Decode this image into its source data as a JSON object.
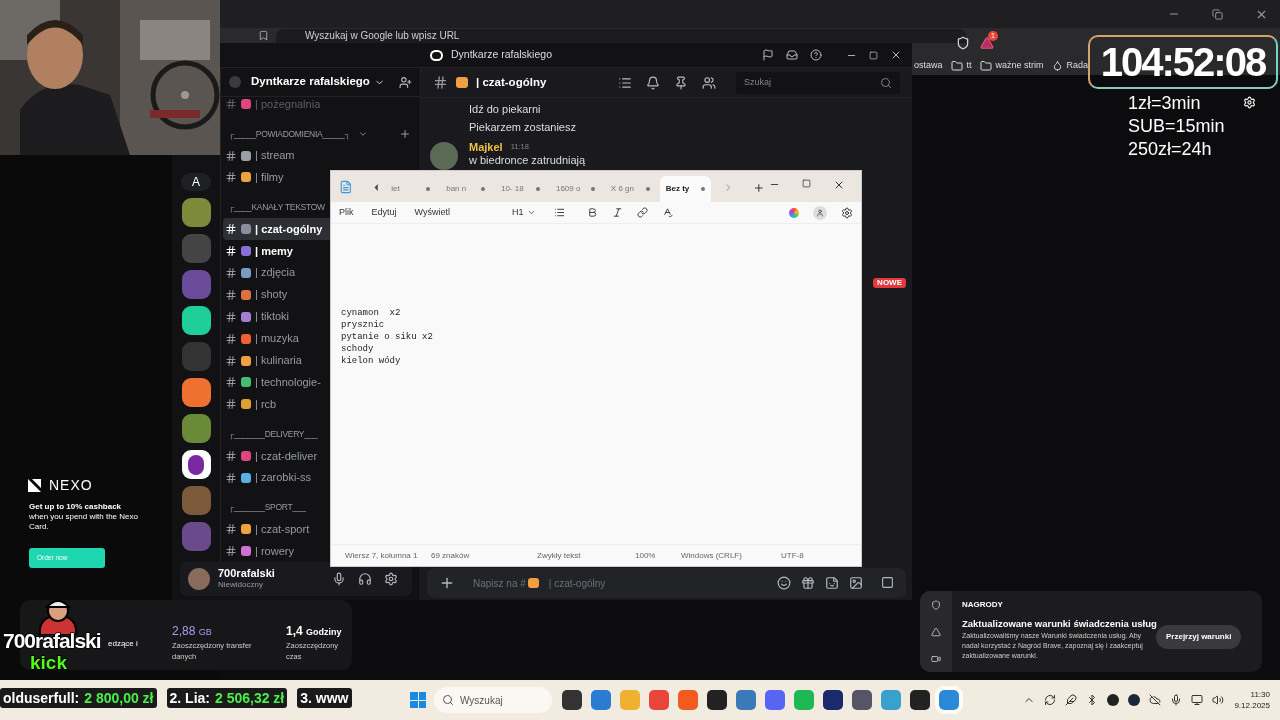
{
  "browser": {
    "address_placeholder": "Wyszukaj w Google lub wpisz URL",
    "rewards_badge": "1",
    "bookmarks": [
      "ostawa",
      "tt",
      "ważne strim",
      "Rada"
    ]
  },
  "timer": {
    "time": "104:52:08",
    "rates": [
      "1zł=3min",
      "SUB=15min",
      "250zł=24h"
    ]
  },
  "discord": {
    "window_title": "Dyntkarze rafalskiego",
    "server_name": "Dyntkarze rafalskiego",
    "rail_label": "A",
    "channels": [
      {
        "kind": "channel",
        "name": "| pożegnalnia",
        "selected": false,
        "unread": false,
        "muted": true
      },
      {
        "kind": "category",
        "name": "┌_____POWIADOMIENIA_____┐",
        "hovered": true
      },
      {
        "kind": "channel",
        "name": "| stream",
        "selected": false,
        "unread": false,
        "muted": false
      },
      {
        "kind": "channel",
        "name": "| filmy",
        "selected": false,
        "unread": false,
        "muted": false
      },
      {
        "kind": "category",
        "name": "┌____KANAŁY TEKSTOW",
        "hovered": false
      },
      {
        "kind": "channel",
        "name": "| czat-ogólny",
        "selected": true,
        "unread": false,
        "muted": false
      },
      {
        "kind": "channel",
        "name": "| memy",
        "selected": false,
        "unread": true,
        "muted": false
      },
      {
        "kind": "channel",
        "name": "| zdjęcia",
        "selected": false,
        "unread": false,
        "muted": false
      },
      {
        "kind": "channel",
        "name": "| shoty",
        "selected": false,
        "unread": false,
        "muted": false
      },
      {
        "kind": "channel",
        "name": "| tiktoki",
        "selected": false,
        "unread": false,
        "muted": false
      },
      {
        "kind": "channel",
        "name": "| muzyka",
        "selected": false,
        "unread": false,
        "muted": false
      },
      {
        "kind": "channel",
        "name": "| kulinaria",
        "selected": false,
        "unread": false,
        "muted": false
      },
      {
        "kind": "channel",
        "name": "| technologie-",
        "selected": false,
        "unread": false,
        "muted": false
      },
      {
        "kind": "channel",
        "name": "| rcb",
        "selected": false,
        "unread": false,
        "muted": false
      },
      {
        "kind": "category",
        "name": "┌_______DELIVERY___",
        "hovered": false
      },
      {
        "kind": "channel",
        "name": "| czat-deliver",
        "selected": false,
        "unread": false,
        "muted": false
      },
      {
        "kind": "channel",
        "name": "| zarobki-ss",
        "selected": false,
        "unread": false,
        "muted": false
      },
      {
        "kind": "category",
        "name": "┌_______SPORT___",
        "hovered": false
      },
      {
        "kind": "channel",
        "name": "| czat-sport",
        "selected": false,
        "unread": false,
        "muted": false
      },
      {
        "kind": "channel",
        "name": "| rowery",
        "selected": false,
        "unread": false,
        "muted": false
      }
    ],
    "channel_title": "| czat-ogólny",
    "search_placeholder": "Szukaj",
    "messages": [
      {
        "kind": "continuation",
        "text": "Idź do piekarni"
      },
      {
        "kind": "continuation",
        "text": "Piekarzem zostaniesz"
      },
      {
        "kind": "message",
        "author": "Majkel",
        "time": "11:18",
        "text": "w biedronce zatrudniają"
      }
    ],
    "new_badge": "NOWE",
    "user": {
      "name": "700rafalski",
      "status": "Niewidoczny"
    },
    "input": {
      "prefix": "Napisz na #",
      "channel": "| czat-ogólny"
    }
  },
  "notepad": {
    "tabs": [
      {
        "label": "iet",
        "selected": false
      },
      {
        "label": "ban n",
        "selected": false
      },
      {
        "label": "10- 18",
        "selected": false
      },
      {
        "label": "1609 o",
        "selected": false
      },
      {
        "label": "X 6 gn",
        "selected": false
      },
      {
        "label": "Bez ty",
        "selected": true
      }
    ],
    "menu": [
      "Plik",
      "Edytuj",
      "Wyświetl"
    ],
    "heading_level": "H1",
    "lines": [
      "cynamon  x2",
      "prysznic",
      "pytanie o siku x2",
      "schody",
      "kielon wódy"
    ],
    "status": [
      "Wiersz 7, kolumna 1",
      "69 znaków",
      "Zwykły tekst",
      "100%",
      "Windows (CRLF)",
      "UTF-8"
    ]
  },
  "ad": {
    "brand": "NEXO",
    "text": "**Get up to 10% cashback** when you spend with the Nexo Card.",
    "button": "Order now"
  },
  "stats": {
    "partial": "edzące i",
    "items": [
      {
        "value": "2,88",
        "unit": "GB",
        "label": "Zaoszczędzony transfer danych"
      },
      {
        "value": "1,4",
        "unit": "Godziny",
        "label": "Zaoszczędzony czas"
      }
    ]
  },
  "logo": {
    "name": "700rafalski",
    "platform": "kick"
  },
  "notification": {
    "title": "NAGRODY",
    "heading": "Zaktualizowane warunki świadczenia usług",
    "body": "Zaktualizowaliśmy nasze Warunki świadczenia usług. Aby nadal korzystać z Nagród Brave, zapoznaj się i zaakceptuj zaktualizowane warunki.",
    "button": "Przejrzyj warunki"
  },
  "ticker": [
    {
      "name": "olduserfull:",
      "amount": "2 800,00 zł"
    },
    {
      "name": "2. Lia:",
      "amount": "2 506,32 zł"
    },
    {
      "name": "3. www"
    }
  ],
  "taskbar": {
    "search_placeholder": "Wyszukaj",
    "time": "11:30",
    "date": "9.12.2025"
  }
}
